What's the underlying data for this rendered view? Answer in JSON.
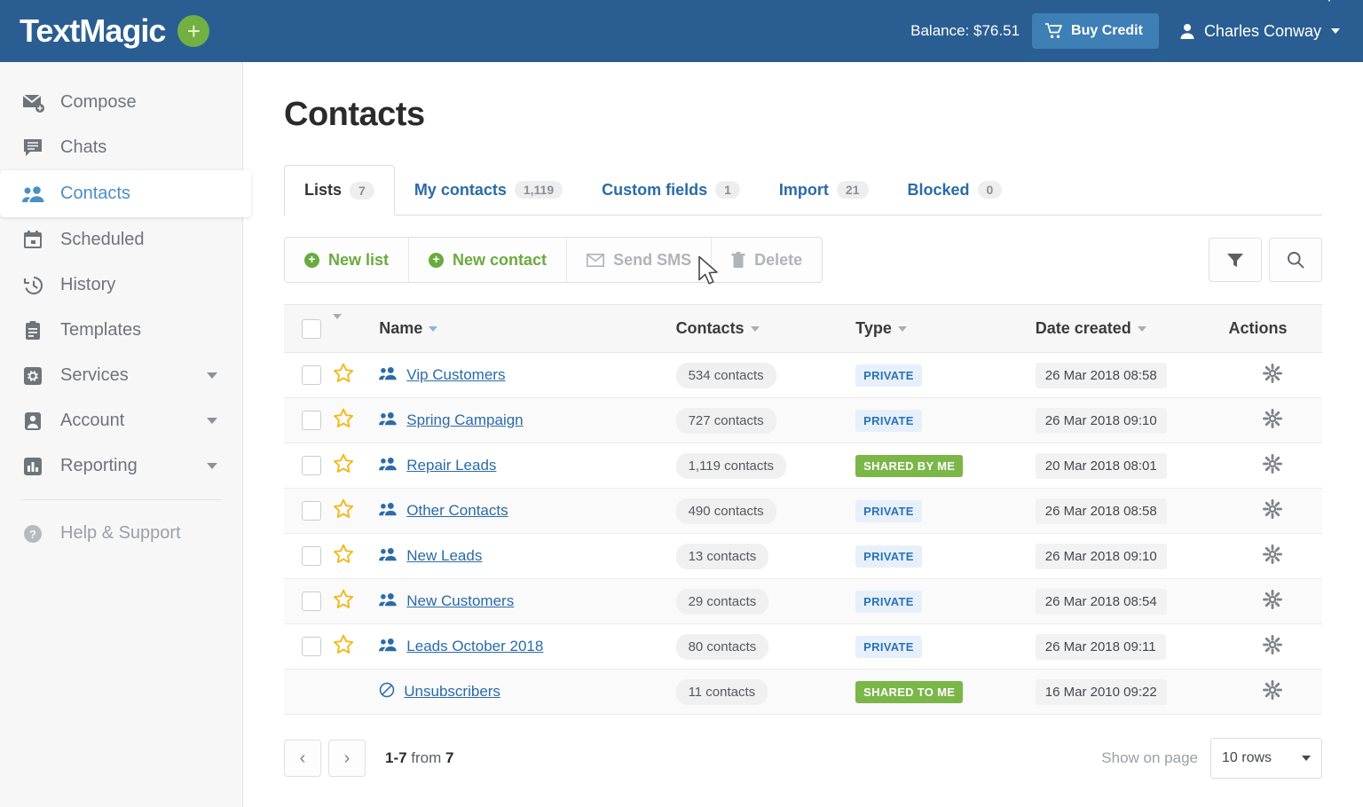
{
  "topbar": {
    "logo_text": "TextMagic",
    "logo_wifi_icon": "wifi-icon",
    "add_button_label": "+",
    "balance_label": "Balance: $76.51",
    "buy_credit_label": "Buy Credit",
    "cart_icon": "shopping-cart-icon",
    "user_name": "Charles Conway",
    "user_icon": "person-icon"
  },
  "sidebar": {
    "items": [
      {
        "label": "Compose",
        "icon": "envelope-plus-icon",
        "active": false,
        "caret": false
      },
      {
        "label": "Chats",
        "icon": "chat-bubble-icon",
        "active": false,
        "caret": false
      },
      {
        "label": "Contacts",
        "icon": "people-icon",
        "active": true,
        "caret": false
      },
      {
        "label": "Scheduled",
        "icon": "calendar-icon",
        "active": false,
        "caret": false
      },
      {
        "label": "History",
        "icon": "clock-rewind-icon",
        "active": false,
        "caret": false
      },
      {
        "label": "Templates",
        "icon": "clipboard-icon",
        "active": false,
        "caret": false
      },
      {
        "label": "Services",
        "icon": "gear-square-icon",
        "active": false,
        "caret": true
      },
      {
        "label": "Account",
        "icon": "person-square-icon",
        "active": false,
        "caret": true
      },
      {
        "label": "Reporting",
        "icon": "bar-chart-icon",
        "active": false,
        "caret": true
      },
      {
        "label": "Help & Support",
        "icon": "question-circle-icon",
        "active": false,
        "caret": false
      }
    ]
  },
  "main": {
    "page_title": "Contacts",
    "tabs": [
      {
        "label": "Lists",
        "badge": "7",
        "active": true
      },
      {
        "label": "My contacts",
        "badge": "1,119",
        "active": false
      },
      {
        "label": "Custom fields",
        "badge": "1",
        "active": false
      },
      {
        "label": "Import",
        "badge": "21",
        "active": false
      },
      {
        "label": "Blocked",
        "badge": "0",
        "active": false
      }
    ],
    "toolbar": {
      "new_list_label": "New list",
      "new_contact_label": "New contact",
      "send_sms_label": "Send SMS",
      "delete_label": "Delete",
      "send_sms_icon": "envelope-icon",
      "delete_icon": "trash-icon",
      "filter_icon": "funnel-icon",
      "search_icon": "search-icon"
    },
    "table": {
      "columns": {
        "name": "Name",
        "contacts": "Contacts",
        "type": "Type",
        "date_created": "Date created",
        "actions": "Actions"
      },
      "rows": [
        {
          "name": "Vip Customers",
          "icon": "people-icon",
          "contacts": "534 contacts",
          "type": "PRIVATE",
          "type_style": "private",
          "date": "26 Mar 2018 08:58",
          "starred": true,
          "checkbox": true
        },
        {
          "name": "Spring Campaign",
          "icon": "people-icon",
          "contacts": "727 contacts",
          "type": "PRIVATE",
          "type_style": "private",
          "date": "26 Mar 2018 09:10",
          "starred": true,
          "checkbox": true
        },
        {
          "name": "Repair Leads",
          "icon": "people-icon",
          "contacts": "1,119 contacts",
          "type": "SHARED BY ME",
          "type_style": "shared",
          "date": "20 Mar 2018 08:01",
          "starred": true,
          "checkbox": true
        },
        {
          "name": "Other Contacts",
          "icon": "people-icon",
          "contacts": "490 contacts",
          "type": "PRIVATE",
          "type_style": "private",
          "date": "26 Mar 2018 08:58",
          "starred": true,
          "checkbox": true
        },
        {
          "name": "New Leads",
          "icon": "people-icon",
          "contacts": "13 contacts",
          "type": "PRIVATE",
          "type_style": "private",
          "date": "26 Mar 2018 09:10",
          "starred": true,
          "checkbox": true
        },
        {
          "name": "New Customers",
          "icon": "people-icon",
          "contacts": "29 contacts",
          "type": "PRIVATE",
          "type_style": "private",
          "date": "26 Mar 2018 08:54",
          "starred": true,
          "checkbox": true
        },
        {
          "name": "Leads October 2018",
          "icon": "people-icon",
          "contacts": "80 contacts",
          "type": "PRIVATE",
          "type_style": "private",
          "date": "26 Mar 2018 09:11",
          "starred": true,
          "checkbox": true
        },
        {
          "name": "Unsubscribers",
          "icon": "no-entry-icon",
          "contacts": "11 contacts",
          "type": "SHARED TO ME",
          "type_style": "shared",
          "date": "16 Mar 2010 09:22",
          "starred": false,
          "checkbox": false
        }
      ]
    },
    "footer": {
      "prev_label": "‹",
      "next_label": "›",
      "range_bold_1": "1-7",
      "range_mid": " from ",
      "range_bold_2": "7",
      "show_on_page_label": "Show on page",
      "rows_value": "10 rows"
    }
  },
  "colors": {
    "header_blue": "#2a5e92",
    "accent_green": "#6aab3e",
    "badge_green": "#7ab648",
    "link_blue": "#2a6ba8",
    "star_gold": "#f2b919"
  }
}
